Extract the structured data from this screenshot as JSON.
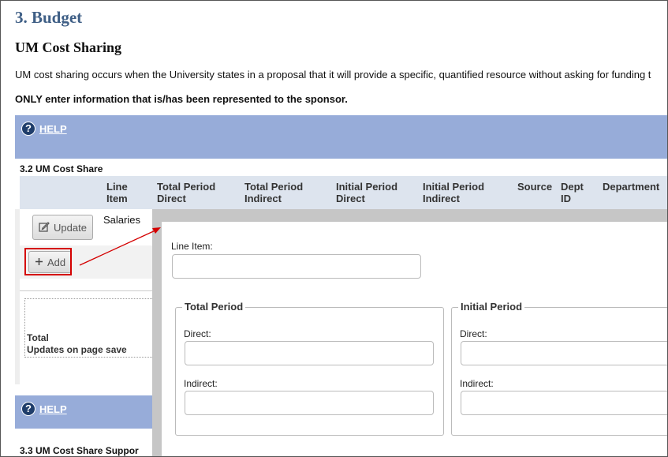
{
  "page": {
    "title": "3. Budget",
    "subtitle": "UM Cost Sharing",
    "description": "UM cost sharing occurs when the University states in a proposal that it will provide a specific, quantified resource without asking for funding t",
    "notice": "ONLY enter information that is/has been represented to the sponsor."
  },
  "help": {
    "label": "HELP",
    "icon": "?"
  },
  "section_32": {
    "title": "3.2 UM Cost Share",
    "columns": [
      "Line\nItem",
      "Total Period\nDirect",
      "Total Period\nIndirect",
      "Initial Period\nDirect",
      "Initial Period\nIndirect",
      "Source",
      "Dept\nID",
      "Department"
    ],
    "row": {
      "update_label": "Update",
      "line_item": "Salaries"
    },
    "add_label": "Add",
    "totals": {
      "line1": "Total",
      "line2": "Updates on page save"
    }
  },
  "section_33": {
    "title": "3.3 UM Cost Share Suppor"
  },
  "form": {
    "line_item_label": "Line Item:",
    "total_period": {
      "legend": "Total Period",
      "direct_label": "Direct:",
      "indirect_label": "Indirect:"
    },
    "initial_period": {
      "legend": "Initial Period",
      "direct_label": "Direct:",
      "indirect_label": "Indirect:"
    }
  },
  "colors": {
    "title": "#3f5f86",
    "help_bar": "#97acd9",
    "header_row": "#dde4ee",
    "highlight": "#d40000"
  }
}
